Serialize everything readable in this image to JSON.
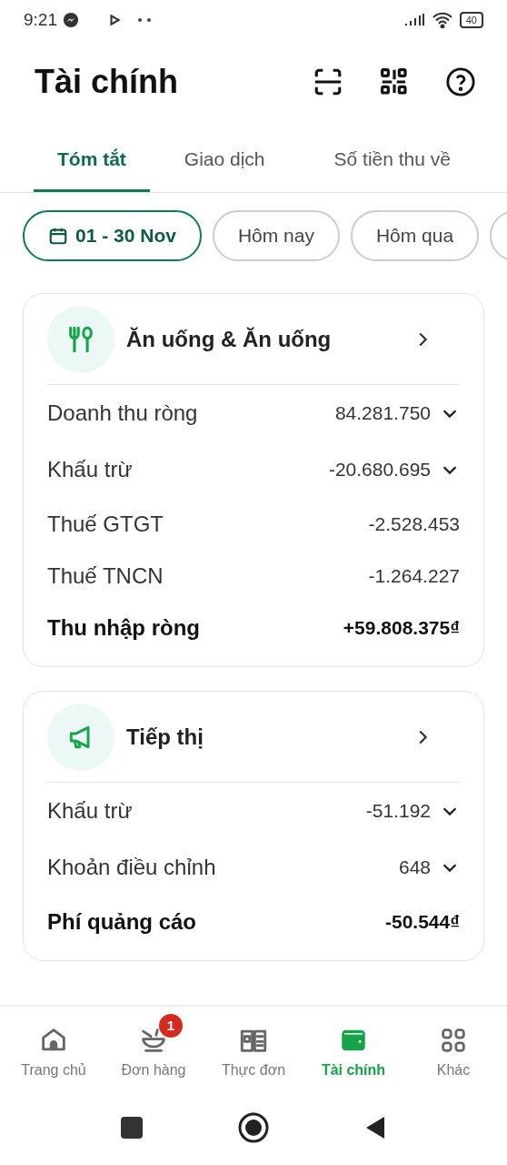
{
  "status_bar": {
    "time": "9:21",
    "battery": "40"
  },
  "header": {
    "title": "Tài chính"
  },
  "tabs": [
    {
      "label": "Tóm tắt",
      "selected": true
    },
    {
      "label": "Giao dịch",
      "selected": false
    },
    {
      "label": "Số tiền thu về",
      "selected": false
    }
  ],
  "filters": [
    {
      "label": "01 - 30 Nov",
      "selected": true,
      "kind": "date"
    },
    {
      "label": "Hôm nay",
      "selected": false,
      "kind": "plain"
    },
    {
      "label": "Hôm qua",
      "selected": false,
      "kind": "plain"
    }
  ],
  "cards": [
    {
      "title": "Ăn uống & Ăn uống",
      "kind": "food",
      "rows": [
        {
          "label": "Doanh thu ròng",
          "value": "84.281.750",
          "kind": "expandable"
        },
        {
          "label": "Khấu trừ",
          "value": "-20.680.695",
          "kind": "expandable"
        },
        {
          "label": "Thuế GTGT",
          "value": "-2.528.453",
          "kind": "plain"
        },
        {
          "label": "Thuế TNCN",
          "value": "-1.264.227",
          "kind": "plain"
        },
        {
          "label": "Thu nhập ròng",
          "value": "+59.808.375₫",
          "kind": "total"
        }
      ]
    },
    {
      "title": "Tiếp thị",
      "kind": "marketing",
      "rows": [
        {
          "label": "Khấu trừ",
          "value": "-51.192",
          "kind": "expandable"
        },
        {
          "label": "Khoản điều chỉnh",
          "value": "648",
          "kind": "expandable"
        },
        {
          "label": "Phí quảng cáo",
          "value": "-50.544₫",
          "kind": "total"
        }
      ]
    }
  ],
  "bottom_nav": [
    {
      "label": "Trang chủ",
      "selected": false,
      "kind": "home"
    },
    {
      "label": "Đơn hàng",
      "selected": false,
      "kind": "orders",
      "badge": "1"
    },
    {
      "label": "Thực đơn",
      "selected": false,
      "kind": "menu"
    },
    {
      "label": "Tài chính",
      "selected": true,
      "kind": "finance"
    },
    {
      "label": "Khác",
      "selected": false,
      "kind": "more"
    }
  ]
}
